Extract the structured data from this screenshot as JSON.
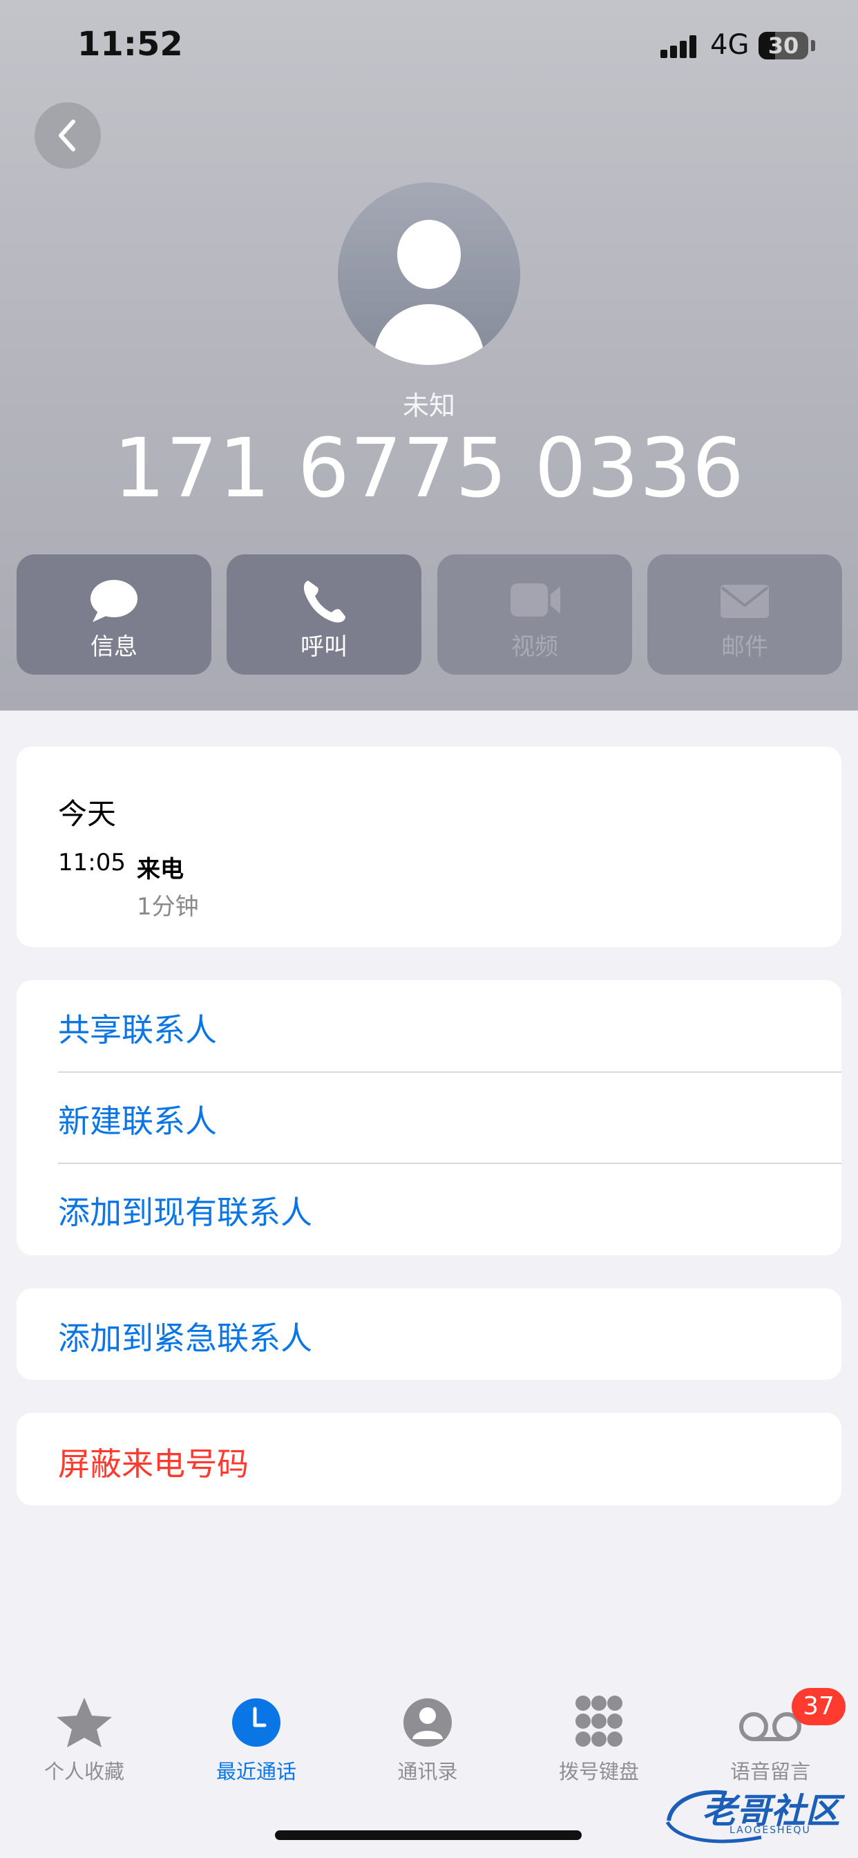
{
  "status_bar": {
    "time": "11:52",
    "network": "4G",
    "battery": "30"
  },
  "contact": {
    "label": "未知",
    "phone": "171 6775 0336"
  },
  "actions": [
    {
      "label": "信息",
      "icon": "message-bubble-icon",
      "enabled": true
    },
    {
      "label": "呼叫",
      "icon": "phone-icon",
      "enabled": true
    },
    {
      "label": "视频",
      "icon": "video-camera-icon",
      "enabled": false
    },
    {
      "label": "邮件",
      "icon": "envelope-icon",
      "enabled": false
    }
  ],
  "call_history": {
    "day": "今天",
    "time": "11:05",
    "type": "来电",
    "duration": "1分钟"
  },
  "options": {
    "share_contact": "共享联系人",
    "new_contact": "新建联系人",
    "add_existing": "添加到现有联系人",
    "add_emergency": "添加到紧急联系人",
    "block_caller": "屏蔽来电号码"
  },
  "tabs": [
    {
      "label": "个人收藏",
      "icon": "star-icon",
      "active": false
    },
    {
      "label": "最近通话",
      "icon": "clock-icon",
      "active": true
    },
    {
      "label": "通讯录",
      "icon": "person-circle-icon",
      "active": false
    },
    {
      "label": "拨号键盘",
      "icon": "keypad-icon",
      "active": false
    },
    {
      "label": "语音留言",
      "icon": "voicemail-icon",
      "active": false
    }
  ],
  "voicemail_badge": "37",
  "watermark": {
    "text": "老哥社区",
    "sub": "LAOGESHEQU"
  },
  "colors": {
    "link": "#0a76e5",
    "destructive": "#ff3b30",
    "header_bg": "#b3b4bc"
  }
}
